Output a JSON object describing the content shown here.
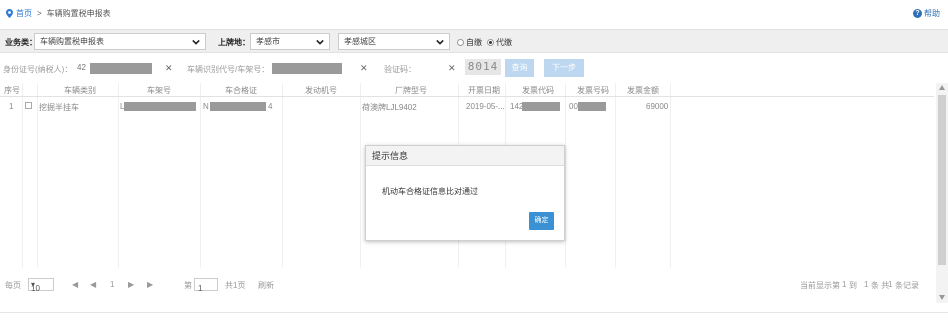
{
  "breadcrumb": {
    "home": "首页",
    "separator": ">",
    "current": "车辆购置税申报表"
  },
  "help": {
    "label": "帮助"
  },
  "filter": {
    "business_type_label": "业务类：",
    "business_type_value": "车辆购置税申报表",
    "plate_place_label": "上牌地：",
    "plate_city": "孝感市",
    "plate_district": "孝感城区",
    "radio_self": "自缴",
    "radio_agent": "代缴"
  },
  "search": {
    "id_label": "身份证号(纳税人)：",
    "id_value": "42",
    "vin_label": "车辆识别代号/车架号：",
    "verify_label": "验证码：",
    "captcha_text": "8014",
    "query_button": "查询",
    "next_button": "下一步"
  },
  "grid": {
    "headers": [
      "序号",
      "车辆类别",
      "车架号",
      "车合格证",
      "发动机号",
      "厂牌型号",
      "开票日期",
      "发票代码",
      "发票号码",
      "发票金额"
    ],
    "rows": [
      {
        "index": "1",
        "category": "挖掘半挂车",
        "vin": "L",
        "cert": "N",
        "cert_tail": "4",
        "engine": "",
        "model": "荷澳牌LJL9402",
        "date": "2019-05-...",
        "invoice_code": "142",
        "invoice_no": "00",
        "amount": "69000"
      }
    ]
  },
  "pager": {
    "per_page_label": "每页",
    "per_page_value": "10",
    "first": "◀",
    "prev": "◀",
    "page_num": "1",
    "next": "▶",
    "last": "▶",
    "page_label": "第",
    "page_value": "1",
    "total_pages": "共1页",
    "refresh": "刷新",
    "display_info": "当前显示第",
    "from": "1",
    "to_label": "到",
    "to": "1",
    "total_label": "条 共",
    "total": "1",
    "records": "条记录"
  },
  "dialog": {
    "title": "提示信息",
    "message": "机动车合格证信息比对通过",
    "ok": "确定"
  },
  "colors": {
    "link": "#2b7bd6",
    "primary_button": "#3a92d4",
    "disabled_button": "#bcd7ef",
    "redaction": "#9a9a9a"
  }
}
